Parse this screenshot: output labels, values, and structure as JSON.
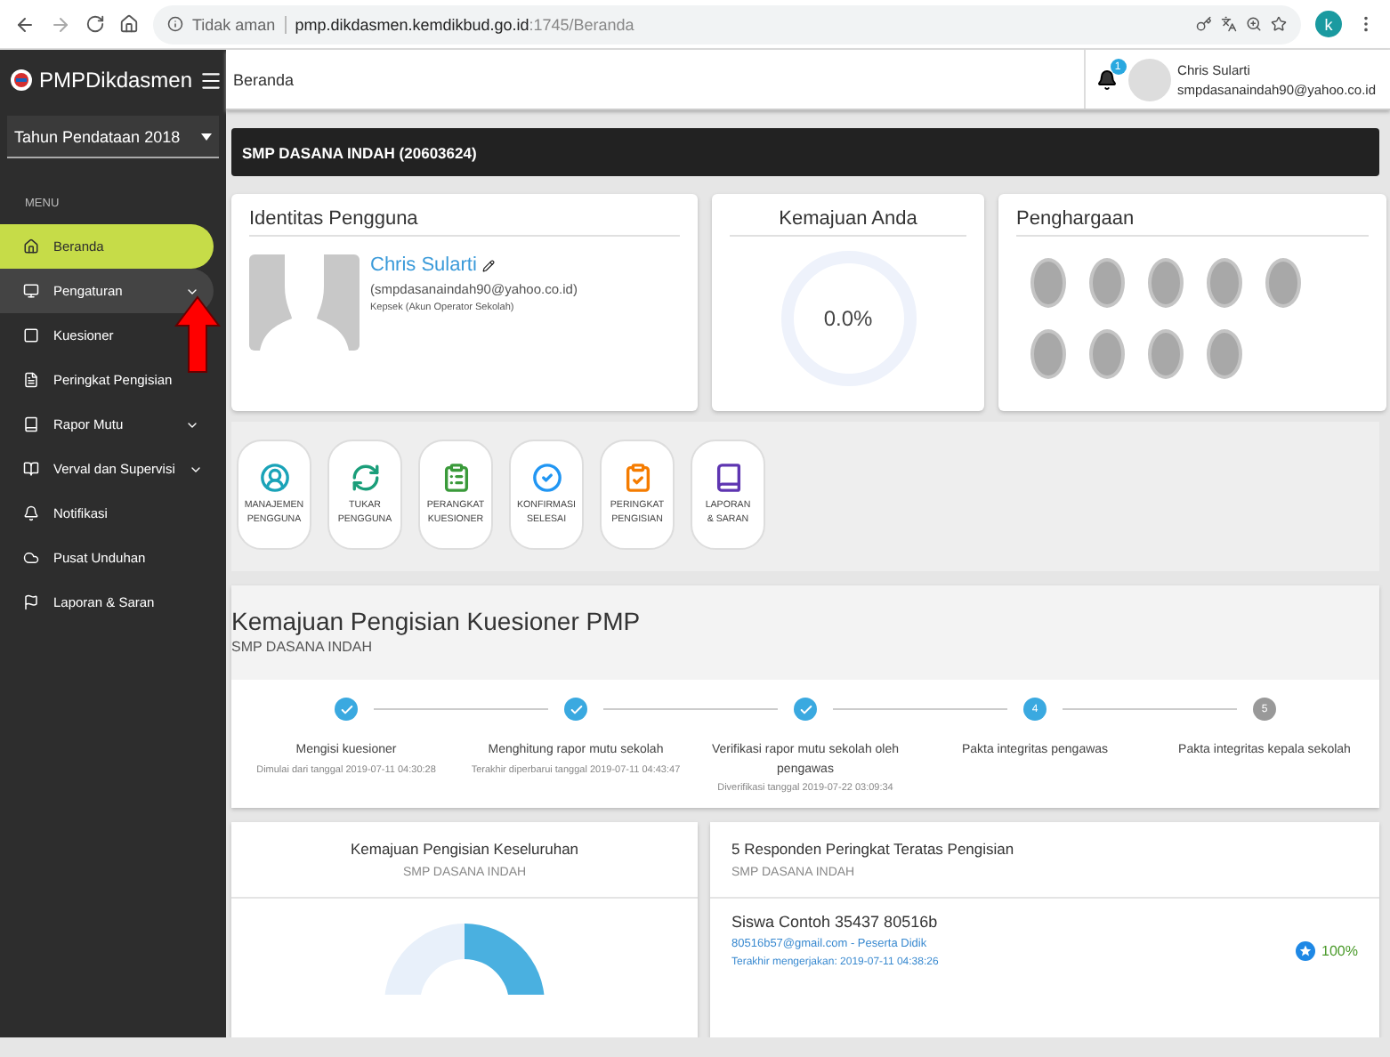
{
  "browser": {
    "security": "Tidak aman",
    "url_host": "pmp.dikdasmen.kemdikbud.go.id",
    "url_path": ":1745/Beranda",
    "profile_initial": "k"
  },
  "app": {
    "brand": "PMPDikdasmen",
    "breadcrumb": "Beranda",
    "notification_count": "1",
    "user_name": "Chris Sularti",
    "user_email": "smpdasanaindah90@yahoo.co.id"
  },
  "sidebar": {
    "year": "Tahun Pendataan 2018",
    "section": "MENU",
    "items": [
      {
        "label": "Beranda",
        "selected": true,
        "has_submenu": false
      },
      {
        "label": "Pengaturan",
        "selected": false,
        "has_submenu": true,
        "hovered": true
      },
      {
        "label": "Kuesioner",
        "selected": false,
        "has_submenu": false
      },
      {
        "label": "Peringkat Pengisian",
        "selected": false,
        "has_submenu": false
      },
      {
        "label": "Rapor Mutu",
        "selected": false,
        "has_submenu": true
      },
      {
        "label": "Verval dan Supervisi",
        "selected": false,
        "has_submenu": true
      },
      {
        "label": "Notifikasi",
        "selected": false,
        "has_submenu": false
      },
      {
        "label": "Pusat Unduhan",
        "selected": false,
        "has_submenu": false
      },
      {
        "label": "Laporan & Saran",
        "selected": false,
        "has_submenu": false
      }
    ]
  },
  "school_bar": "SMP DASANA INDAH (20603624)",
  "identity": {
    "title": "Identitas Pengguna",
    "name": "Chris Sularti",
    "email": "(smpdasanaindah90@yahoo.co.id)",
    "role": "Kepsek (Akun Operator Sekolah)"
  },
  "progress": {
    "title": "Kemajuan Anda",
    "value": "0.0%"
  },
  "awards": {
    "title": "Penghargaan",
    "items": [
      {
        "earned": false
      },
      {
        "earned": false
      },
      {
        "earned": false
      },
      {
        "earned": false
      },
      {
        "earned": false
      },
      {
        "earned": false
      },
      {
        "earned": false
      },
      {
        "earned": false
      },
      {
        "earned": false
      }
    ]
  },
  "shortcuts": [
    {
      "lines": [
        "MANAJEMEN",
        "PENGGUNA"
      ],
      "color": "#1aa3b8"
    },
    {
      "lines": [
        "TUKAR",
        "PENGGUNA"
      ],
      "color": "#1a9e7a"
    },
    {
      "lines": [
        "PERANGKAT",
        "KUESIONER"
      ],
      "color": "#3a9a3a"
    },
    {
      "lines": [
        "KONFIRMASI",
        "SELESAI"
      ],
      "color": "#2196f3"
    },
    {
      "lines": [
        "PERINGKAT",
        "PENGISIAN"
      ],
      "color": "#f57c00"
    },
    {
      "lines": [
        "LAPORAN",
        "& SARAN"
      ],
      "color": "#5e35b1"
    }
  ],
  "questionnaire_progress": {
    "title": "Kemajuan Pengisian Kuesioner PMP",
    "subtitle": "SMP DASANA INDAH",
    "steps": [
      {
        "done": true,
        "title": "Mengisi kuesioner",
        "note": "Dimulai dari tanggal 2019-07-11 04:30:28"
      },
      {
        "done": true,
        "title": "Menghitung rapor mutu sekolah",
        "note": "Terakhir diperbarui tanggal 2019-07-11 04:43:47"
      },
      {
        "done": true,
        "title": "Verifikasi rapor mutu sekolah oleh pengawas",
        "note": "Diverifikasi tanggal 2019-07-22 03:09:34"
      },
      {
        "done": false,
        "active": true,
        "number": "4",
        "title": "Pakta integritas pengawas"
      },
      {
        "done": false,
        "active": false,
        "number": "5",
        "title": "Pakta integritas kepala sekolah"
      }
    ]
  },
  "overall": {
    "title": "Kemajuan Pengisian Keseluruhan",
    "subtitle": "SMP DASANA INDAH"
  },
  "top_respondents": {
    "title": "5 Responden Peringkat Teratas Pengisian",
    "subtitle": "SMP DASANA INDAH",
    "rows": [
      {
        "name": "Siswa Contoh 35437 80516b",
        "contact": "80516b57@gmail.com - Peserta Didik",
        "last": "Terakhir mengerjakan: 2019-07-11 04:38:26",
        "percent": "100%"
      }
    ]
  }
}
